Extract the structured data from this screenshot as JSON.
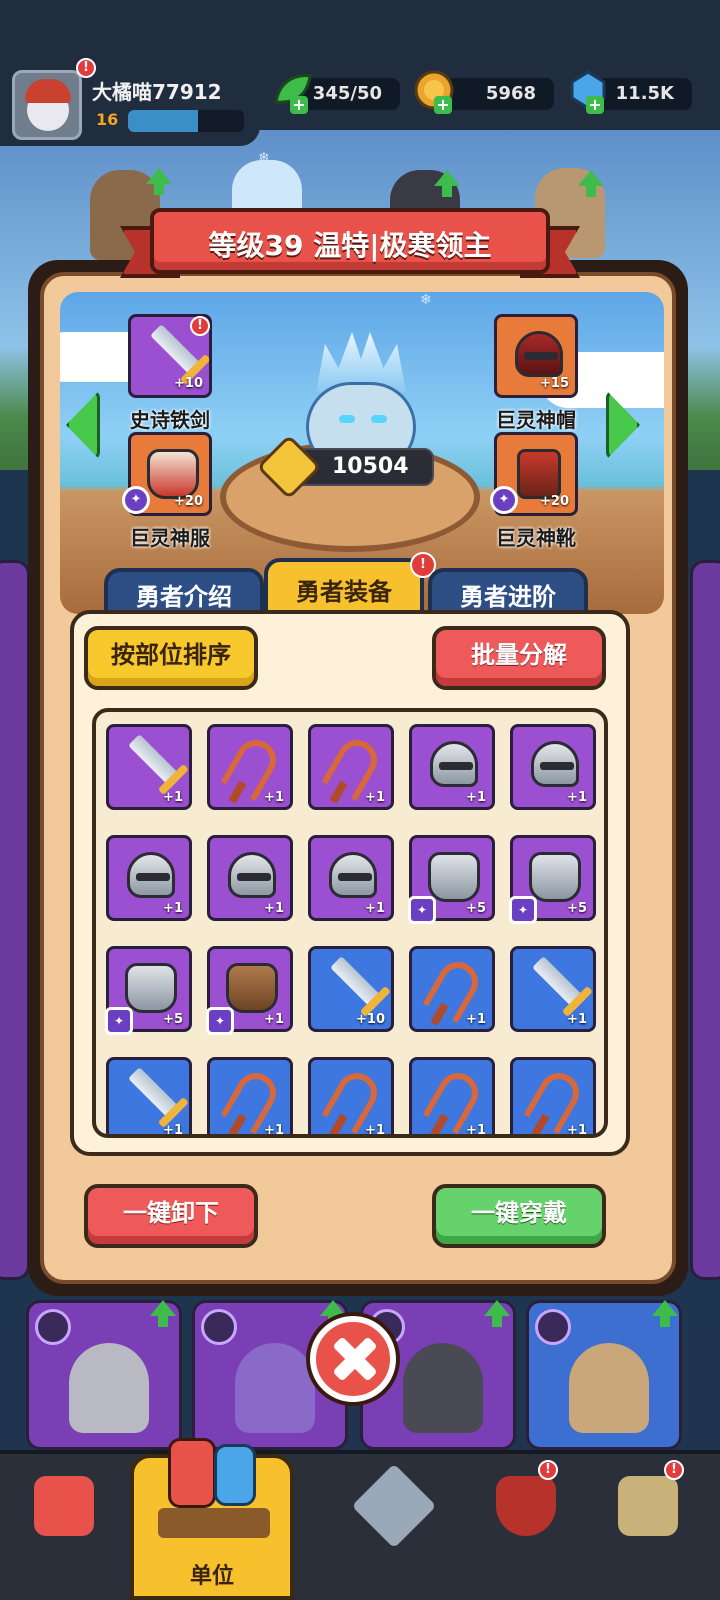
{
  "player": {
    "name": "大橘喵77912",
    "level": "16",
    "xp_fraction": 0.6
  },
  "resources": {
    "energy": "345/50",
    "coins": "5968",
    "gems": "11.5K"
  },
  "hero_title": "等级39 温特|极寒领主",
  "power": "10504",
  "equipped": {
    "weapon": {
      "label": "史诗铁剑",
      "level": "+10"
    },
    "helmet": {
      "label": "巨灵神帽",
      "level": "+15"
    },
    "armor": {
      "label": "巨灵神服",
      "level": "+20"
    },
    "boots": {
      "label": "巨灵神靴",
      "level": "+20"
    }
  },
  "tabs": [
    "勇者介绍",
    "勇者装备",
    "勇者进阶"
  ],
  "active_tab": "勇者装备",
  "buttons": {
    "sort": "按部位排序",
    "batch_decompose": "批量分解",
    "unequip_all": "一键卸下",
    "equip_all": "一键穿戴"
  },
  "inventory": [
    {
      "type": "sword",
      "rarity": "purple",
      "level": "+1"
    },
    {
      "type": "slingshot",
      "rarity": "purple",
      "level": "+1"
    },
    {
      "type": "slingshot",
      "rarity": "purple",
      "level": "+1"
    },
    {
      "type": "helmet",
      "rarity": "purple",
      "level": "+1"
    },
    {
      "type": "helmet",
      "rarity": "purple",
      "level": "+1"
    },
    {
      "type": "helmet",
      "rarity": "purple",
      "level": "+1"
    },
    {
      "type": "helmet",
      "rarity": "purple",
      "level": "+1"
    },
    {
      "type": "helmet",
      "rarity": "purple",
      "level": "+1"
    },
    {
      "type": "armor",
      "rarity": "purple",
      "level": "+5"
    },
    {
      "type": "armor",
      "rarity": "purple",
      "level": "+5"
    },
    {
      "type": "armor",
      "rarity": "purple",
      "level": "+5"
    },
    {
      "type": "leather",
      "rarity": "purple",
      "level": "+1"
    },
    {
      "type": "sword",
      "rarity": "blue",
      "level": "+10"
    },
    {
      "type": "slingshot",
      "rarity": "blue",
      "level": "+1"
    },
    {
      "type": "sword",
      "rarity": "blue",
      "level": "+1"
    },
    {
      "type": "sword",
      "rarity": "blue",
      "level": "+1"
    },
    {
      "type": "slingshot",
      "rarity": "blue",
      "level": "+1"
    },
    {
      "type": "slingshot",
      "rarity": "blue",
      "level": "+1"
    },
    {
      "type": "slingshot",
      "rarity": "blue",
      "level": "+1"
    },
    {
      "type": "slingshot",
      "rarity": "blue",
      "level": "+1"
    }
  ],
  "bottom_nav": {
    "active_label": "单位"
  },
  "icons": {
    "energy": "leaf-icon",
    "coins": "coin-icon",
    "gems": "gem-icon",
    "close": "close-icon"
  },
  "colors": {
    "accent_red": "#e9524a",
    "accent_yellow": "#f6c12c",
    "accent_green": "#66d26b",
    "rarity_purple": "#9b4fd1",
    "rarity_blue": "#3d77df"
  }
}
